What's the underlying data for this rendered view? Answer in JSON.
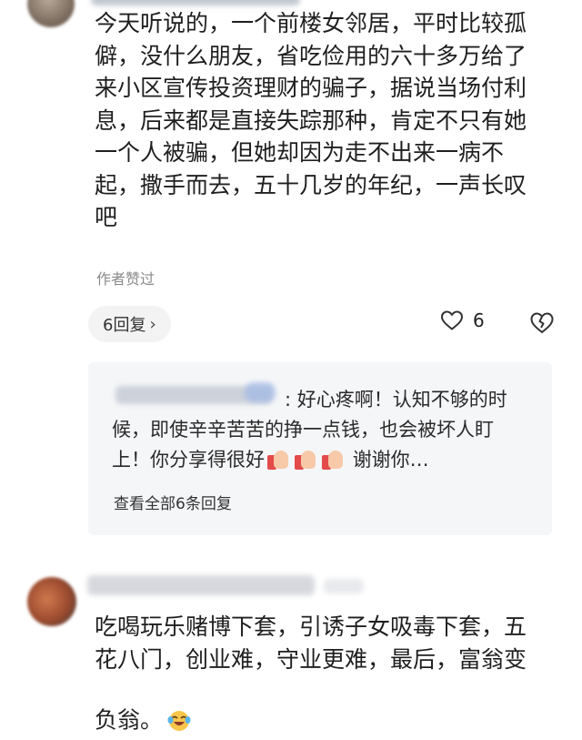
{
  "comment1": {
    "text": "今天听说的，一个前楼女邻居，平时比较孤\n僻，没什么朋友，省吃俭用的六十多万给了\n来小区宣传投资理财的骗子，据说当场付利\n息，后来都是直接失踪那种，肯定不只有她\n一个人被骗，但她却因为走不出来一病不\n起，撒手而去，五十几岁的年纪，一声长叹\n吧",
    "author_liked": "作者赞过",
    "reply_count_label": "6回复",
    "like_count": "6"
  },
  "reply": {
    "sep": ": ",
    "text_a": "好心疼啊！认知不够的时候，即使辛辛苦苦的挣一点钱，也会被坏人盯上！你分享得很好",
    "text_b": "谢谢你…",
    "view_all": "查看全部6条回复"
  },
  "comment2": {
    "text": "吃喝玩乐赌博下套，引诱子女吸毒下套，五\n花八门，创业难，守业更难，最后，富翁变\n负翁。"
  },
  "icons": {
    "like": "heart-outline-icon",
    "dislike": "broken-heart-outline-icon",
    "expand": "chevron-right-icon"
  },
  "colors": {
    "reply_bg": "#f5f6f8",
    "pill_bg": "#f3f3f3",
    "text": "#1f1f1f",
    "muted": "#8a8a8a"
  }
}
